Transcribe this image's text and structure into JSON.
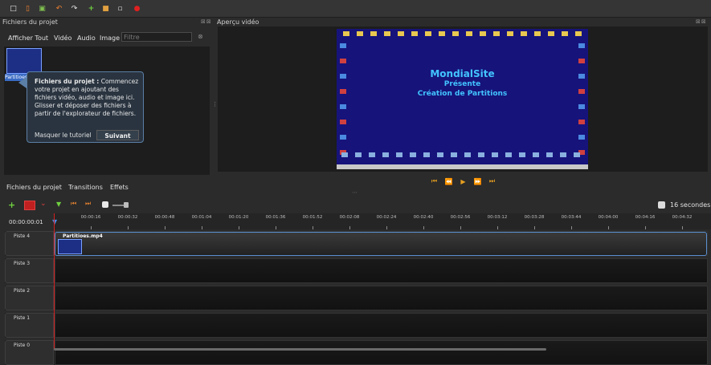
{
  "left_panel": {
    "title": "Fichiers du projet",
    "dock_controls": "⊠⊠",
    "filter_tabs": [
      "Afficher Tout",
      "Vidéo",
      "Audio",
      "Image"
    ],
    "filter_placeholder": "Filtre",
    "file_item": {
      "name": "Partitioes.mp4"
    },
    "tutorial": {
      "heading": "Fichiers du projet :",
      "body": "Commencez votre projet en ajoutant des fichiers vidéo, audio et image ici. Glisser et déposer des fichiers à partir de l'explorateur de fichiers.",
      "hide_label": "Masquer le tutoriel",
      "next_label": "Suivant"
    },
    "bottom_tabs": [
      "Fichiers du projet",
      "Transitions",
      "Effets"
    ]
  },
  "preview": {
    "title": "Aperçu vidéo",
    "dock_controls": "⊠⊠",
    "video_line1": "MondialSite",
    "video_line2": "Présente",
    "video_line3": "Création de Partitions",
    "accent_color": "#e8a020"
  },
  "timeline": {
    "zoom_label": "16 secondes",
    "timecode": "00:00:00:01",
    "ruler_labels": [
      "00:00:16",
      "00:00:32",
      "00:00:48",
      "00:01:04",
      "00:01:20",
      "00:01:36",
      "00:01:52",
      "00:02:08",
      "00:02:24",
      "00:02:40",
      "00:02:56",
      "00:03:12",
      "00:03:28",
      "00:03:44",
      "00:04:00",
      "00:04:16",
      "00:04:32"
    ],
    "tracks": [
      "Piste 4",
      "Piste 3",
      "Piste 2",
      "Piste 1",
      "Piste 0"
    ],
    "clip_name": "Partitioes.mp4"
  },
  "icons": {
    "toolbar": [
      "new-project-icon",
      "open-project-icon",
      "save-project-icon",
      "undo-icon",
      "redo-icon",
      "import-files-icon",
      "choose-profile-icon",
      "fullscreen-icon",
      "export-video-icon"
    ],
    "timeline_tools": [
      "add-track-icon",
      "snap-icon",
      "razor-icon",
      "add-marker-icon",
      "previous-marker-icon",
      "next-marker-icon",
      "zoom-icon"
    ]
  }
}
